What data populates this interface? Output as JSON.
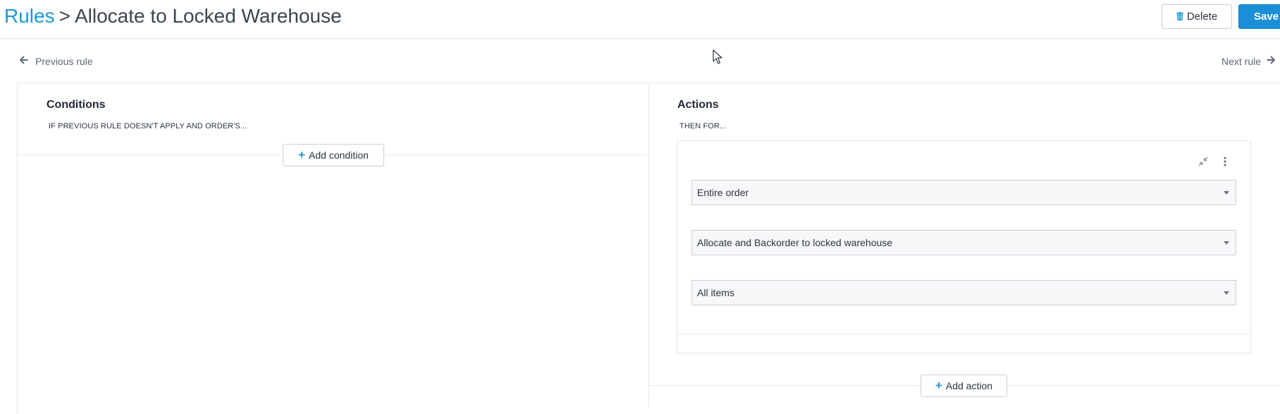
{
  "header": {
    "breadcrumb_root": "Rules",
    "breadcrumb_separator": ">",
    "breadcrumb_current": "Allocate to Locked Warehouse",
    "delete_label": "Delete",
    "save_label": "Save"
  },
  "navigation": {
    "previous_label": "Previous rule",
    "next_label": "Next rule"
  },
  "conditions": {
    "title": "Conditions",
    "subtitle": "IF PREVIOUS RULE DOESN'T APPLY AND ORDER'S...",
    "add_label": "Add condition"
  },
  "actions": {
    "title": "Actions",
    "subtitle": "THEN FOR...",
    "selects": [
      {
        "value": "Entire order"
      },
      {
        "value": "Allocate and Backorder to locked warehouse"
      },
      {
        "value": "All items"
      }
    ],
    "add_label": "Add action"
  },
  "colors": {
    "accent": "#1a9ad6",
    "save_button": "#1a8fd8",
    "border": "#c9ced6",
    "text": "#2b3440"
  },
  "icons": {
    "delete": "trash-icon",
    "previous": "arrow-left-icon",
    "next": "arrow-right-icon",
    "add": "plus-icon",
    "collapse": "collapse-icon",
    "menu": "kebab-menu-icon",
    "select": "caret-down-icon"
  }
}
